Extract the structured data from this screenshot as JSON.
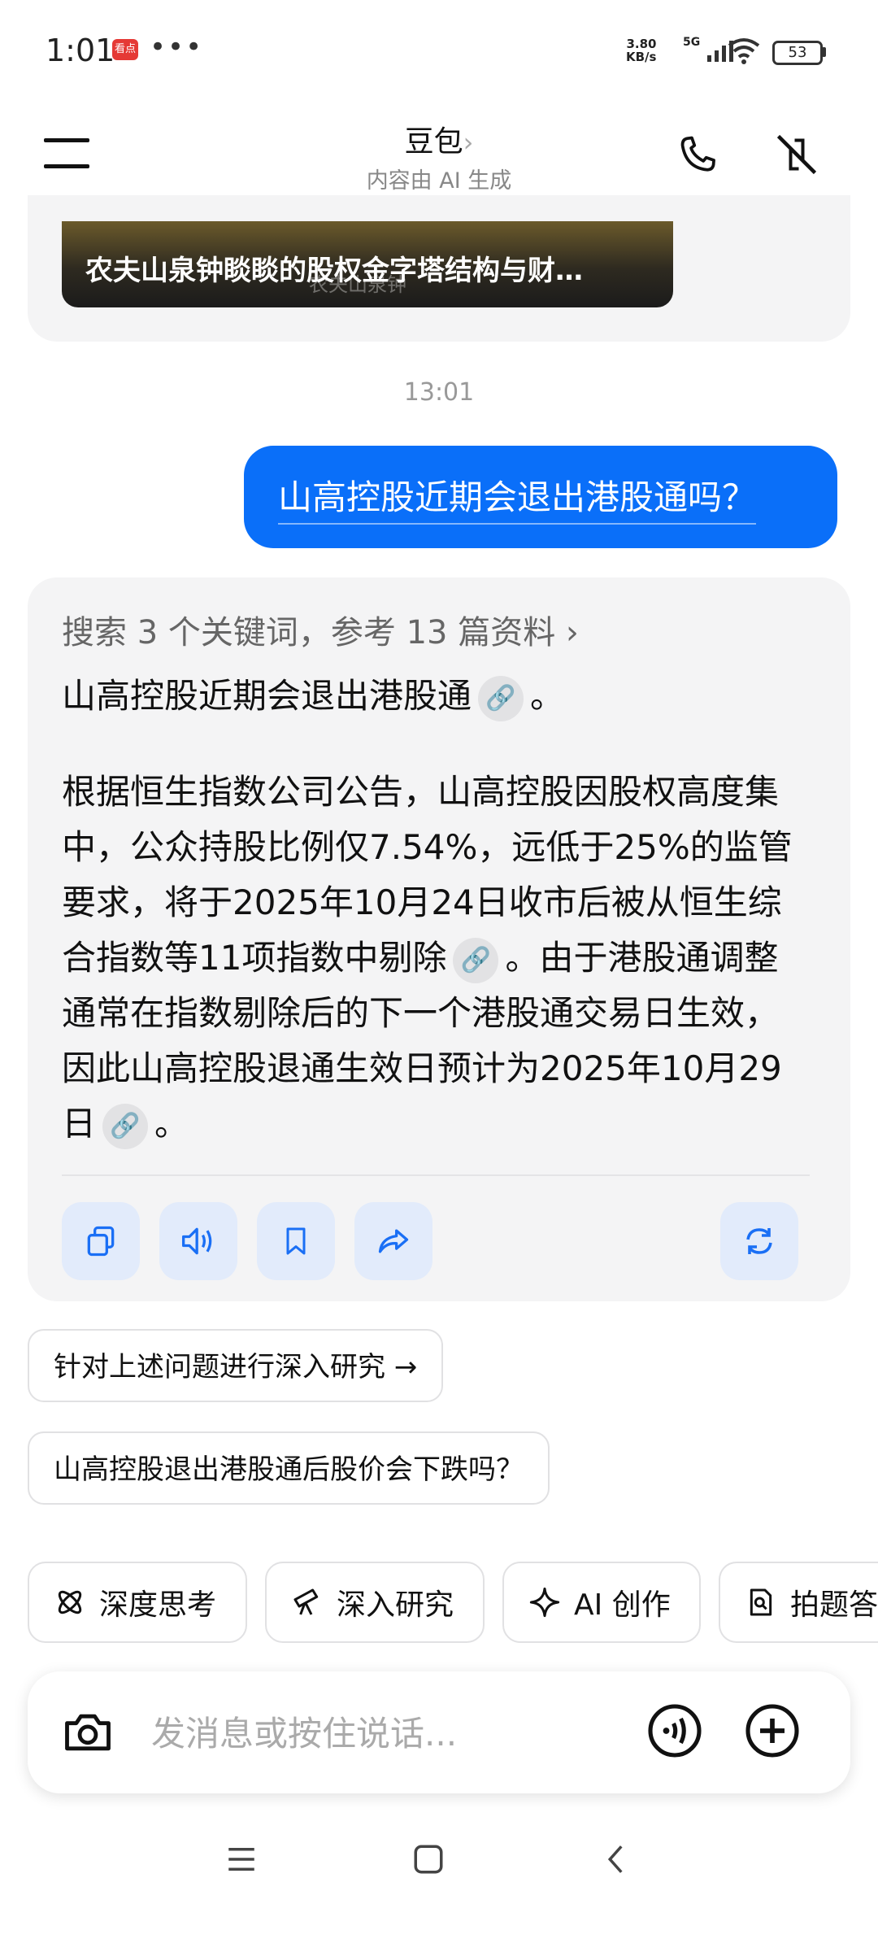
{
  "status_bar": {
    "time": "1:01",
    "news_badge": "看点",
    "more": "•••",
    "net_speed_value": "3.80",
    "net_speed_unit": "KB/s",
    "network": "5G",
    "battery": "53"
  },
  "header": {
    "title": "豆包",
    "chevron": "›",
    "subtitle": "内容由 AI 生成"
  },
  "top_card": {
    "title": "农夫山泉钟睒睒的股权金字塔结构与财…",
    "watermark": "农夫山泉钟"
  },
  "chat": {
    "timestamp": "13:01",
    "user_message": "山高控股近期会退出港股通吗？",
    "search_summary": "搜索 3 个关键词，参考 13 篇资料 ›",
    "answer_line1": "山高控股近期会退出港股通",
    "answer_line1_end": "。",
    "answer_para_a": "根据恒生指数公司公告，山高控股因股权高度集中，公众持股比例仅7.54%，远低于25%的监管要求，将于2025年10月24日收市后被从恒生综合指数等11项指数中剔除",
    "answer_para_b": "。由于港股通调整通常在指数剔除后的下一个港股通交易日生效，因此山高控股退通生效日预计为2025年10月29日",
    "answer_para_end": "。"
  },
  "suggestions": [
    "针对上述问题进行深入研究 →",
    "山高控股退出港股通后股价会下跌吗？"
  ],
  "tools": [
    {
      "label": "深度思考",
      "icon": "atom-icon"
    },
    {
      "label": "深入研究",
      "icon": "telescope-icon"
    },
    {
      "label": "AI 创作",
      "icon": "sparkle-icon"
    },
    {
      "label": "拍题答",
      "icon": "scan-doc-icon"
    }
  ],
  "input": {
    "placeholder": "发消息或按住说话..."
  },
  "colors": {
    "accent": "#0a6ff9",
    "card_bg": "#f4f4f5",
    "action_bg": "#e2ebfb"
  }
}
